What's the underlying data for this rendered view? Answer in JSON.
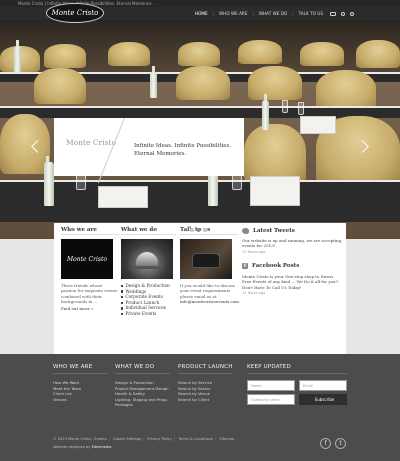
{
  "topbar": {
    "text": "Monte Cristo | Infinite Ideas. Infinite Possibilities. Eternal Memories."
  },
  "brand": {
    "logo_text": "Monte Cristo"
  },
  "nav": {
    "items": [
      "HOME",
      "WHO WE ARE",
      "WHAT WE DO",
      "TALK TO US"
    ],
    "active_index": 1,
    "icons": [
      "email-icon",
      "facebook-icon",
      "twitter-icon"
    ]
  },
  "hero": {
    "title": "Monte Cristo",
    "tagline": "Infinite Ideas. Infinite Possibilities. Eternal Memories.",
    "caption": "Slide",
    "slide_count": 3,
    "active_slide": 2
  },
  "features": {
    "who": {
      "heading": "Who we are",
      "image_text": "Monte Cristo",
      "body": "Three friends whose passion for exquisite events combined with their backgrounds in ...",
      "more": "Find out more »"
    },
    "what": {
      "heading": "What we do",
      "items": [
        "Design & Production",
        "Weddings",
        "Corporate Events",
        "Product Launch",
        "Individual Services",
        "Private Events"
      ]
    },
    "talk": {
      "heading": "Talk to us",
      "body": "If you would like to discuss your event requirements please email us at",
      "email": "info@montecristoevents.com"
    },
    "tweets": {
      "heading": "Latest Tweets",
      "text": "Our website is up and running, we are accepting events for 2013!",
      "time": "12 Hours ago"
    },
    "facebook": {
      "heading": "Facebook Posts",
      "text": "Monte Cristo is your One-stop shop to Stress Free Events of any kind ... We Do it all for you!! Don't Have To Call Us Today!",
      "time": "12 Hours ago"
    }
  },
  "footer": {
    "col1": {
      "heading": "WHO WE ARE",
      "links": [
        "How We Work",
        "Meet the Team",
        "Client List",
        "Venues"
      ]
    },
    "col2": {
      "heading": "WHAT WE DO",
      "links": [
        "Design & Production",
        "Project Management Design",
        "Health & Safety",
        "Lighting, Staging and Props",
        "Packages"
      ]
    },
    "col3": {
      "heading": "PRODUCT LAUNCH",
      "links": [
        "Search by Service",
        "Search by Sector",
        "Search by Venue",
        "Search by Client"
      ]
    },
    "col4": {
      "heading": "KEEP UPDATED",
      "name_placeholder": "Name",
      "email_placeholder": "Email",
      "company_placeholder": "Company name",
      "subscribe_label": "Subscribe"
    },
    "bottom_links": [
      "© 2013 Monte Cristo - Events",
      "Cookie Settings",
      "Privacy Policy",
      "Terms & Conditions",
      "Sitemap"
    ],
    "credit_prefix": "Website designed by",
    "credit_name": "Edesmedia"
  },
  "colors": {
    "header_bg": "#2c2c2c",
    "footer_bg": "#4c4c4a",
    "features_bg": "#e6e6e6",
    "chair_gold": "#c7ac6a"
  }
}
